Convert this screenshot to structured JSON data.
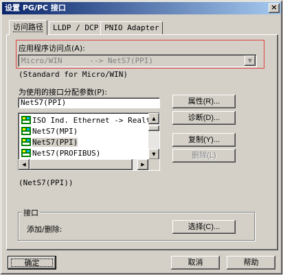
{
  "window": {
    "title": "设置 PG/PC 接口",
    "close_glyph": "×"
  },
  "tabs": [
    {
      "label": "访问路径"
    },
    {
      "label": "LLDP / DCP"
    },
    {
      "label": "PNIO Adapter"
    }
  ],
  "access_point": {
    "label": "应用程序访问点(A):",
    "value": "Micro/WIN      --> NetS7(PPI)",
    "note": "(Standard for Micro/WIN)"
  },
  "interface": {
    "label": "为使用的接口分配参数(P):",
    "value": "NetS7(PPI)",
    "list": [
      {
        "label": "ISO Ind. Ethernet -> Realtek"
      },
      {
        "label": "NetS7(MPI)"
      },
      {
        "label": "NetS7(PPI)"
      },
      {
        "label": "NetS7(PROFIBUS)"
      }
    ],
    "status": "(NetS7(PPI))"
  },
  "buttons": {
    "properties": "属性(R)...",
    "diagnostics": "诊断(D)...",
    "copy": "复制(Y)...",
    "delete": "删除(L)",
    "select": "选择(C)...",
    "ok": "确定",
    "cancel": "取消",
    "help": "帮助"
  },
  "group": {
    "title": "接口",
    "add_remove": "添加/删除:"
  },
  "colors": {
    "highlight_frame": "#e04040",
    "titlebar_start": "#0a246a",
    "titlebar_end": "#a6caf0",
    "face": "#d4d0c8"
  },
  "icons": {
    "list_item_icon": "network-adapter-icon",
    "combo_arrow": "chevron-down-icon"
  }
}
